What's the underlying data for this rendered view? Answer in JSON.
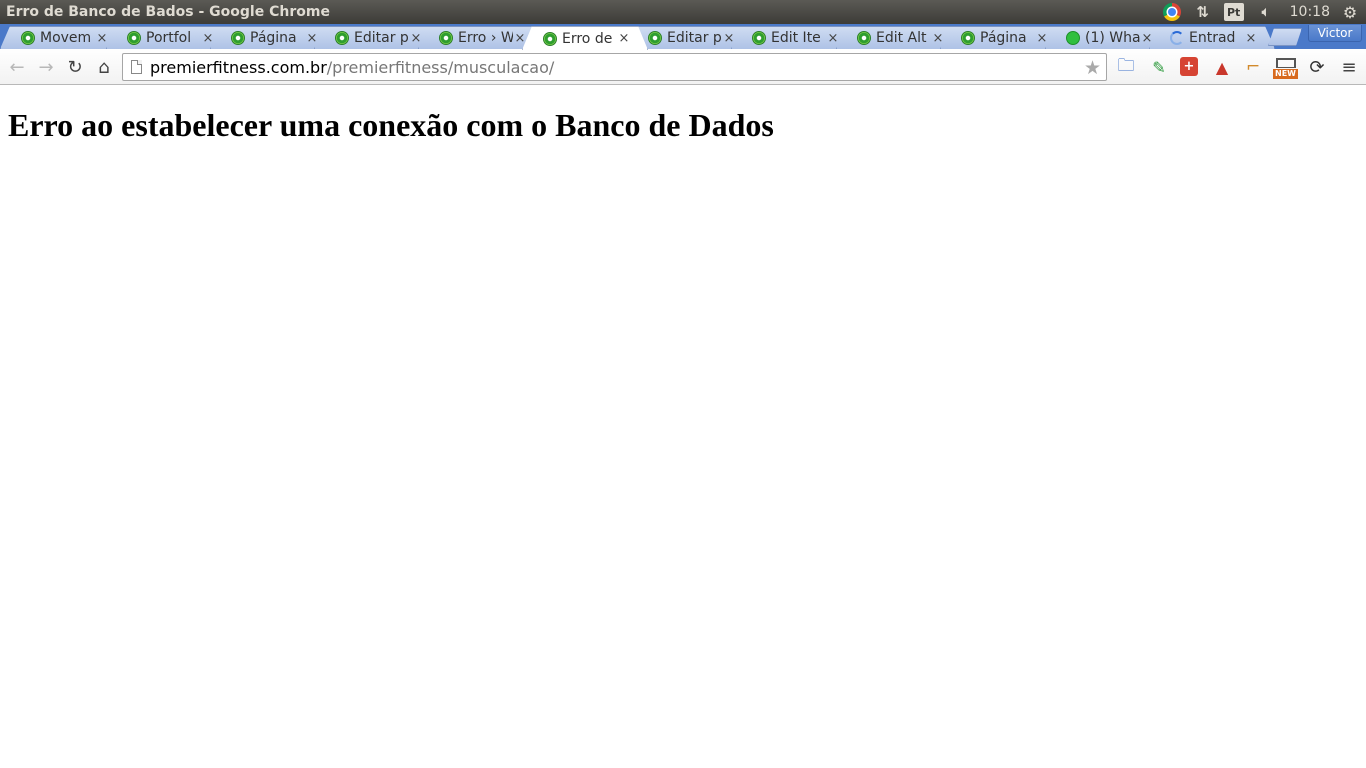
{
  "window": {
    "title": "Erro de Banco de Bados - Google Chrome"
  },
  "tray": {
    "browser_icon": "chrome-icon",
    "network_icon": "network-arrows-icon",
    "keyboard_layout": "Pt",
    "volume_icon": "volume-icon",
    "clock": "10:18",
    "settings_icon": "gear-icon"
  },
  "tabs": [
    {
      "label": "Movem",
      "favicon": "site-favicon",
      "active": false
    },
    {
      "label": "Portfol",
      "favicon": "site-favicon",
      "active": false
    },
    {
      "label": "Página",
      "favicon": "site-favicon",
      "active": false
    },
    {
      "label": "Editar p",
      "favicon": "site-favicon",
      "active": false
    },
    {
      "label": "Erro › W",
      "favicon": "site-favicon",
      "active": false
    },
    {
      "label": "Erro de",
      "favicon": "site-favicon",
      "active": true
    },
    {
      "label": "Editar p",
      "favicon": "site-favicon",
      "active": false
    },
    {
      "label": "Edit Ite",
      "favicon": "site-favicon",
      "active": false
    },
    {
      "label": "Edit Alt",
      "favicon": "site-favicon",
      "active": false
    },
    {
      "label": "Página",
      "favicon": "site-favicon",
      "active": false
    },
    {
      "label": "(1) Wha",
      "favicon": "whatsapp-favicon",
      "active": false
    },
    {
      "label": "Entrad",
      "favicon": "loading-spinner",
      "active": false
    }
  ],
  "tab_close_glyph": "×",
  "profile": {
    "name": "Victor"
  },
  "toolbar": {
    "back_icon": "back-arrow-icon",
    "forward_icon": "forward-arrow-icon",
    "reload_icon": "reload-icon",
    "home_icon": "home-icon",
    "url_host": "premierfitness.com.br",
    "url_path": "/premierfitness/musculacao/",
    "bookmark_icon": "star-icon",
    "extensions": [
      "folder-icon",
      "eyedropper-icon",
      "lastpass-icon",
      "lock-icon",
      "hammer-icon",
      "new-screenshot-icon",
      "refresh-icon",
      "menu-icon"
    ],
    "new_badge": "NEW"
  },
  "page": {
    "heading": "Erro ao estabelecer uma conexão com o Banco de Dados"
  }
}
